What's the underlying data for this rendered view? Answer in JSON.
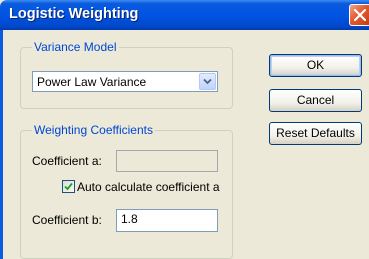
{
  "window": {
    "title": "Logistic Weighting"
  },
  "variance_model": {
    "legend": "Variance Model",
    "selected": "Power Law Variance"
  },
  "weighting": {
    "legend": "Weighting Coefficients",
    "coef_a_label": "Coefficient a:",
    "coef_a_value": "",
    "auto_calc_label": "Auto calculate coefficient a",
    "auto_calc_checked": true,
    "coef_b_label": "Coefficient b:",
    "coef_b_value": "1.8"
  },
  "buttons": {
    "ok": "OK",
    "cancel": "Cancel",
    "reset": "Reset Defaults"
  },
  "colors": {
    "titlebar": "#0054E3",
    "legend_text": "#0046D5",
    "dialog_bg": "#ECE9D8",
    "close_button": "#E2592E"
  },
  "icons": {
    "close": "close-icon",
    "dropdown": "chevron-down-icon",
    "check": "check-icon"
  }
}
